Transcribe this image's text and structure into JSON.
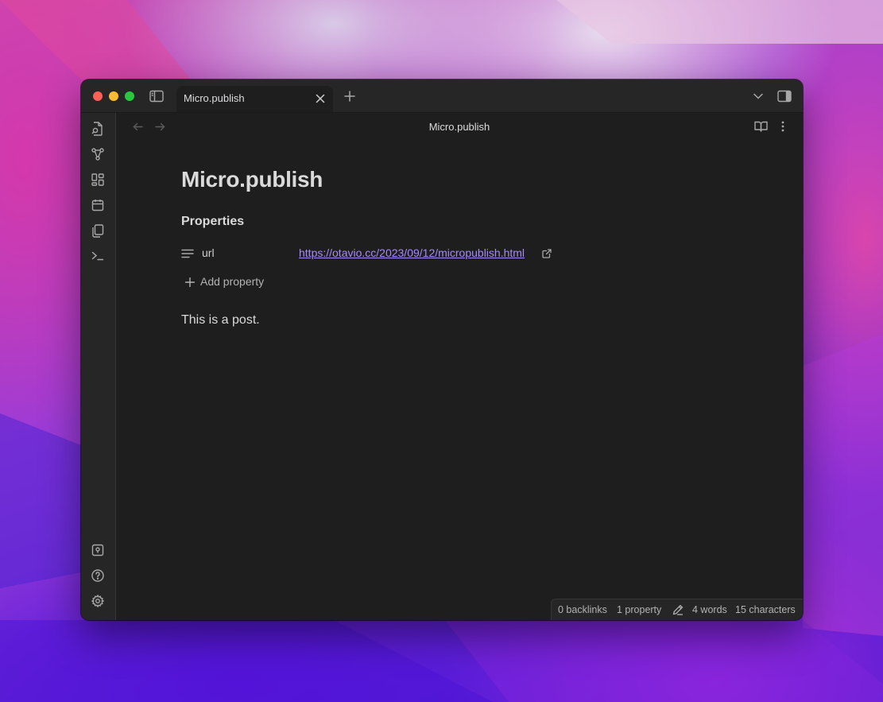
{
  "colors": {
    "window_bg": "#1e1e1e",
    "chrome_bg": "#262626",
    "text": "#dadada",
    "muted": "#a8a8a8",
    "link": "#a68af9"
  },
  "tabs": [
    {
      "label": "Micro.publish",
      "close_icon": "close-icon",
      "active": true
    }
  ],
  "titlebar": {
    "new_tab_icon": "plus-icon",
    "tab_list_icon": "chevron-down-icon",
    "right_sidebar_icon": "sidebar-right-icon",
    "left_sidebar_icon": "sidebar-left-icon"
  },
  "ribbon": {
    "top": [
      "quick-switcher-icon",
      "graph-view-icon",
      "canvas-icon",
      "daily-note-icon",
      "templates-icon",
      "command-palette-icon"
    ],
    "bottom": [
      "vault-switcher-icon",
      "help-icon",
      "settings-icon"
    ]
  },
  "header": {
    "title": "Micro.publish",
    "back_icon": "arrow-left-icon",
    "forward_icon": "arrow-right-icon",
    "reading_view_icon": "book-open-icon",
    "more_icon": "more-vertical-icon"
  },
  "note": {
    "title": "Micro.publish",
    "properties_heading": "Properties",
    "properties": [
      {
        "key": "url",
        "icon": "text-lines-icon",
        "value": "https://otavio.cc/2023/09/12/micropublish.html"
      }
    ],
    "add_property_label": "Add property",
    "body": "This is a post."
  },
  "status_bar": {
    "backlinks": "0 backlinks",
    "properties": "1 property",
    "words": "4 words",
    "characters": "15 characters"
  }
}
